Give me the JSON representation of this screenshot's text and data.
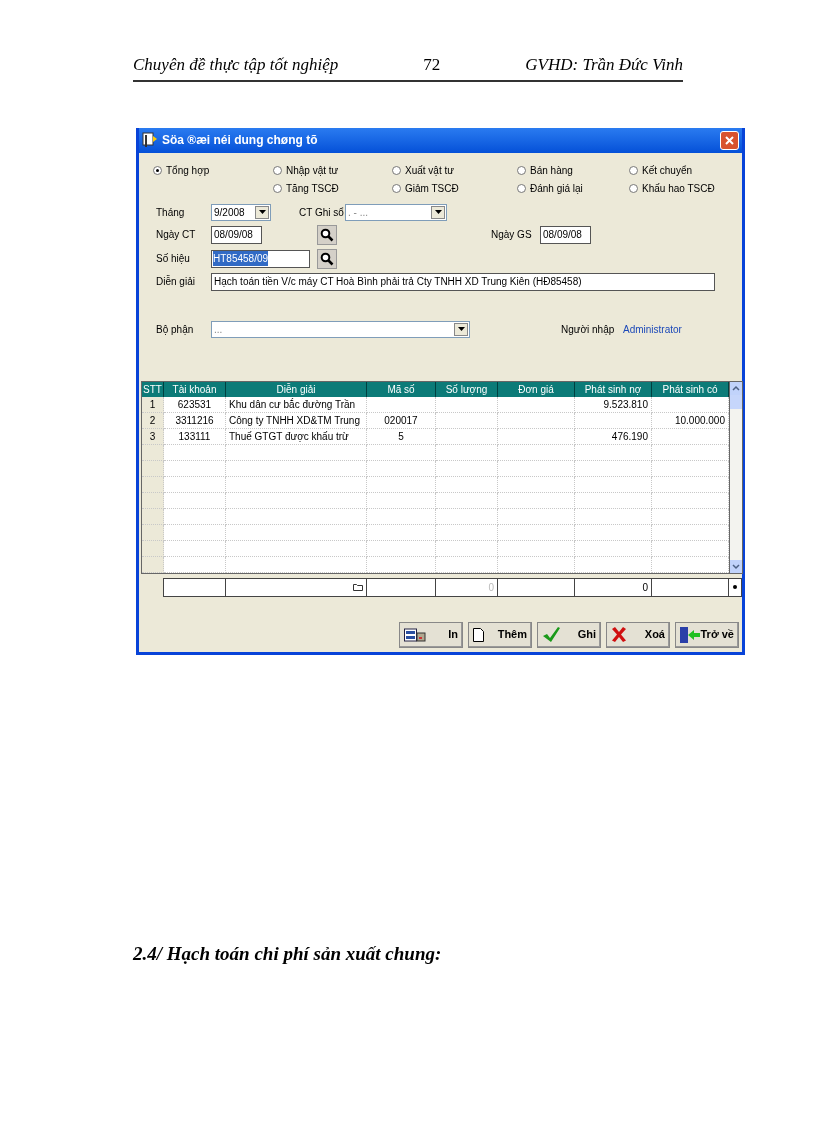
{
  "page_header": {
    "left": "Chuyên đề thực tập tốt nghiệp",
    "page_number": "72",
    "right": "GVHD: Trần Đức Vinh"
  },
  "window": {
    "title": "Söa ®æi néi dung chøng tõ"
  },
  "transaction_types": [
    [
      {
        "label": "Tổng hợp",
        "selected": true
      }
    ],
    [
      {
        "label": "Nhập vật tư",
        "selected": false
      },
      {
        "label": "Tăng TSCĐ",
        "selected": false
      }
    ],
    [
      {
        "label": "Xuất vật tư",
        "selected": false
      },
      {
        "label": "Giảm TSCĐ",
        "selected": false
      }
    ],
    [
      {
        "label": "Bán hàng",
        "selected": false
      },
      {
        "label": "Đánh giá lại",
        "selected": false
      }
    ],
    [
      {
        "label": "Kết chuyển",
        "selected": false
      },
      {
        "label": "Khấu hao TSCĐ",
        "selected": false
      }
    ]
  ],
  "month": {
    "label": "Tháng",
    "value": "9/2008"
  },
  "ledger_voucher": {
    "label": "CT Ghi sổ",
    "value": ". - ..."
  },
  "voucher_date": {
    "label": "Ngày CT",
    "value": "08/09/08"
  },
  "posting_date": {
    "label": "Ngày GS",
    "value": "08/09/08"
  },
  "voucher_number": {
    "label": "Số hiệu",
    "value": "HT85458/09"
  },
  "description": {
    "label": "Diễn giải",
    "value": "Hạch toán tiền V/c máy CT Hoà Bình phải trả Cty TNHH XD Trung Kiên (HĐ85458)"
  },
  "department": {
    "label": "Bộ phận",
    "value": "..."
  },
  "entered_by": {
    "label": "Người nhập",
    "value": "Administrator"
  },
  "grid": {
    "columns": [
      "STT",
      "Tài khoản",
      "Diễn giải",
      "Mã số",
      "Số lượng",
      "Đơn giá",
      "Phát sinh nợ",
      "Phát sinh có"
    ],
    "rows": [
      {
        "stt": "1",
        "account": "623531",
        "description": "Khu dân cư bắc đường Trần",
        "code": "",
        "debit": "9.523.810",
        "credit": ""
      },
      {
        "stt": "2",
        "account": "3311216",
        "description": "Công ty TNHH XD&TM Trung",
        "code": "020017",
        "debit": "",
        "credit": "10.000.000"
      },
      {
        "stt": "3",
        "account": "133111",
        "description": "Thuế GTGT được khấu trừ",
        "code": "5",
        "debit": "476.190",
        "credit": ""
      }
    ],
    "totals": {
      "quantity": {
        "text": "0",
        "disabled": true
      },
      "debit": {
        "text": "0",
        "disabled": false
      }
    }
  },
  "buttons": [
    {
      "label": "In",
      "kind": "print"
    },
    {
      "label": "Thêm",
      "kind": "add"
    },
    {
      "label": "Ghi",
      "kind": "save"
    },
    {
      "label": "Xoá",
      "kind": "delete"
    },
    {
      "label": "Trở về",
      "kind": "back"
    }
  ],
  "section_heading": "2.4/ Hạch toán chi phí sản xuất chung:"
}
